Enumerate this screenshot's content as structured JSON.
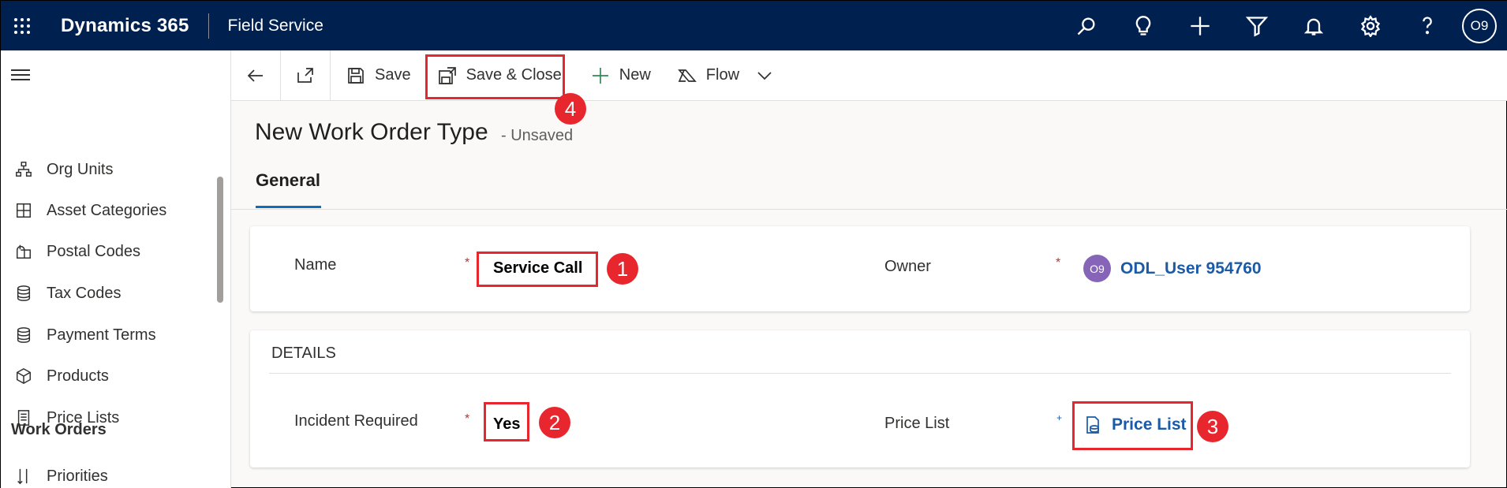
{
  "topbar": {
    "app_title": "Dynamics 365",
    "module": "Field Service",
    "avatar_initials": "O9",
    "icons": [
      "search-icon",
      "lightbulb-icon",
      "plus-icon",
      "filter-icon",
      "bell-icon",
      "gear-icon",
      "help-icon"
    ]
  },
  "sidebar": {
    "items": [
      {
        "label": "Org Units",
        "icon": "org-chart-icon"
      },
      {
        "label": "Asset Categories",
        "icon": "asset-icon"
      },
      {
        "label": "Postal Codes",
        "icon": "mailbox-icon"
      },
      {
        "label": "Tax Codes",
        "icon": "coins-icon"
      },
      {
        "label": "Payment Terms",
        "icon": "coins-icon"
      },
      {
        "label": "Products",
        "icon": "box-icon"
      },
      {
        "label": "Price Lists",
        "icon": "document-list-icon"
      }
    ],
    "section": "Work Orders",
    "section_items": [
      {
        "label": "Priorities",
        "icon": "sort-icon"
      }
    ]
  },
  "commandbar": {
    "save": "Save",
    "save_close": "Save & Close",
    "new": "New",
    "flow": "Flow"
  },
  "header": {
    "title": "New Work Order Type",
    "status": "- Unsaved",
    "tab": "General"
  },
  "form": {
    "name_label": "Name",
    "name_value": "Service Call",
    "owner_label": "Owner",
    "owner_initials": "O9",
    "owner_value": "ODL_User 954760",
    "details_heading": "DETAILS",
    "incident_label": "Incident Required",
    "incident_value": "Yes",
    "pricelist_label": "Price List",
    "pricelist_value": "Price List"
  },
  "callouts": {
    "one": "1",
    "two": "2",
    "three": "3",
    "four": "4"
  },
  "colors": {
    "topbar": "#002050",
    "callout": "#e8262d",
    "link": "#1b5aa6"
  }
}
